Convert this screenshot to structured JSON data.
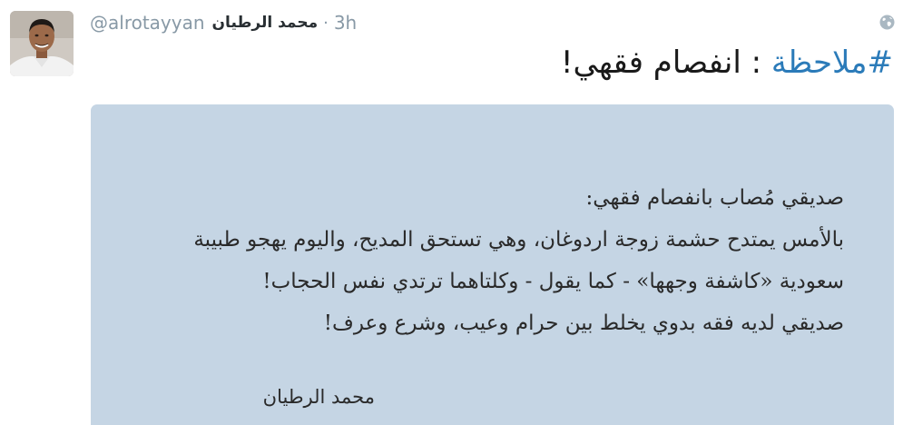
{
  "tweet": {
    "handle": "@alrotayyan",
    "name": "محمد الرطيان",
    "separator": "·",
    "time": "3h",
    "hashtag": "#ملاحظة",
    "text_rest": " : انفصام فقهي!"
  },
  "media": {
    "lines": [
      "صديقي مُصاب بانفصام فقهي:",
      "بالأمس يمتدح حشمة زوجة اردوغان، وهي تستحق المديح، واليوم يهجو طبيبة",
      "سعودية «كاشفة وجهها» - كما يقول - وكلتاهما ترتدي نفس الحجاب!",
      "صديقي لديه فقه بدوي يخلط بين حرام وعيب، وشرع وعرف!"
    ],
    "signature": "محمد الرطيان"
  },
  "icons": {
    "avatar": "profile-photo",
    "globe": "globe-icon"
  },
  "colors": {
    "hashtag": "#2b7bb9",
    "meta": "#8899a6",
    "card_background": "#c5d5e4"
  }
}
